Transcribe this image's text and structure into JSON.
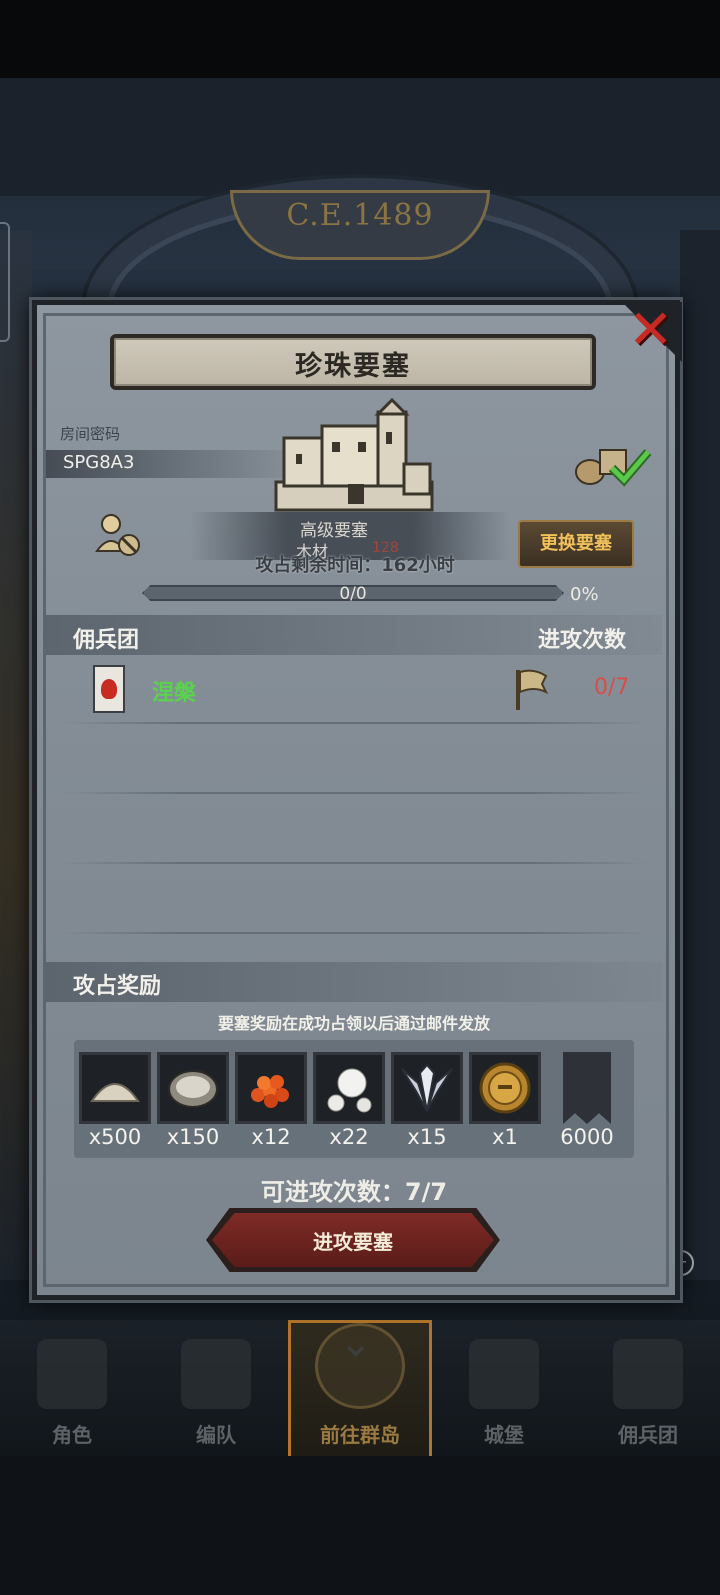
{
  "background": {
    "era": "C.E.1489"
  },
  "dialog": {
    "title": "珍珠要塞",
    "room_label": "房间密码",
    "room_code": "SPG8A3",
    "fortress_type": "高级要塞",
    "fortress_material": "木材",
    "fortress_material_value": "128",
    "occupy_time": "攻占剩余时间：162小时",
    "change_button": "更换要塞",
    "progress_text": "0/0",
    "progress_percent_label": "0%",
    "progress_value": 0,
    "supply_checked": true
  },
  "mercenary_section": {
    "title": "佣兵团",
    "right_header": "进攻次数",
    "rows": [
      {
        "name": "涅槃",
        "attacks": "0/7"
      }
    ]
  },
  "rewards_section": {
    "title": "攻占奖励",
    "note": "要塞奖励在成功占领以后通过邮件发放",
    "items": [
      {
        "icon": "sand-pile-icon",
        "qty": "x500"
      },
      {
        "icon": "oyster-icon",
        "qty": "x150"
      },
      {
        "icon": "roe-icon",
        "qty": "x12"
      },
      {
        "icon": "pearl-icon",
        "qty": "x22"
      },
      {
        "icon": "winged-emblem-icon",
        "qty": "x15"
      },
      {
        "icon": "knight-coin-icon",
        "qty": "x1"
      },
      {
        "icon": "guild-banner-icon",
        "qty": "6000"
      }
    ]
  },
  "attacks_remaining": "可进攻次数：7/7",
  "attack_button": "进攻要塞",
  "bottom_nav": [
    {
      "label": "角色",
      "active": false
    },
    {
      "label": "编队",
      "active": false
    },
    {
      "label": "前往群岛",
      "active": true
    },
    {
      "label": "城堡",
      "active": false
    },
    {
      "label": "佣兵团",
      "active": false
    }
  ],
  "colors": {
    "merc_name": "#5bd24e",
    "attack_count": "#d84d45",
    "change_button_text": "#f0c05a",
    "close_x": "#c72a22"
  }
}
